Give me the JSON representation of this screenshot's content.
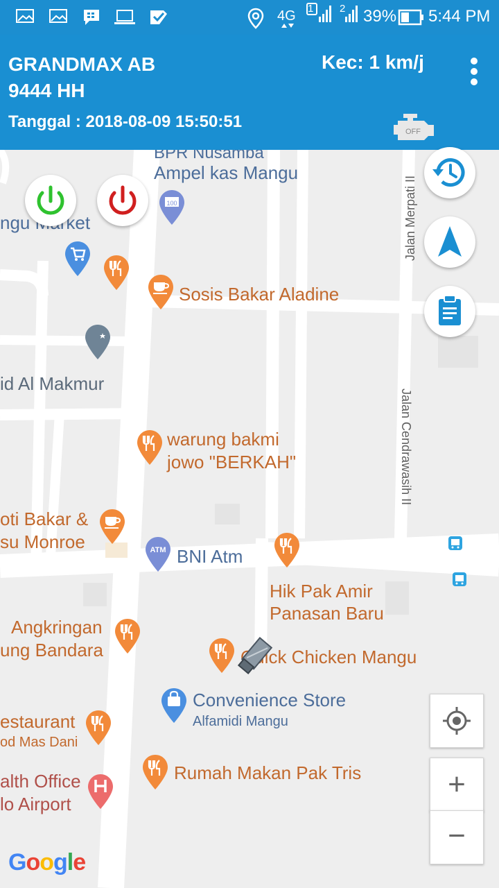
{
  "status_bar": {
    "network": "4G",
    "sim1": "1",
    "sim2": "2",
    "battery": "39%",
    "time": "5:44 PM",
    "icons": [
      "gallery-icon",
      "gallery-icon",
      "bbm-icon",
      "laptop-icon",
      "check-app-icon",
      "location-icon",
      "signal-icon",
      "battery-icon"
    ]
  },
  "header": {
    "vehicle": "GRANDMAX AB\n9444 HH",
    "speed": "Kec: 1 km/j",
    "date": "Tanggal : 2018-08-09 15:50:51",
    "engine_status": "OFF"
  },
  "map": {
    "pois": [
      {
        "name": "BPR Nusamba",
        "line2": "Ampel kas Mangu",
        "color": "blue"
      },
      {
        "name": "ngu Market",
        "color": "blue"
      },
      {
        "name": "Sosis Bakar Aladine",
        "color": "orange"
      },
      {
        "name": "id Al Makmur",
        "color": "slate"
      },
      {
        "name": "warung bakmi",
        "line2": "jowo \"BERKAH\"",
        "color": "orange"
      },
      {
        "name": "oti Bakar &",
        "line2": "su Monroe",
        "color": "orange"
      },
      {
        "name": "BNI Atm",
        "color": "blue"
      },
      {
        "name": "Hik Pak Amir",
        "line2": "Panasan Baru",
        "color": "orange"
      },
      {
        "name": "Angkringan",
        "line2": "ung Bandara",
        "color": "orange"
      },
      {
        "name": "Quick Chicken Mangu",
        "color": "orange"
      },
      {
        "name": "Convenience Store",
        "line2": "Alfamidi Mangu",
        "color": "blue"
      },
      {
        "name": "estaurant",
        "line2": "od Mas Dani",
        "color": "orange"
      },
      {
        "name": "Rumah Makan Pak Tris",
        "color": "orange"
      },
      {
        "name": "alth Office",
        "line2": "lo Airport",
        "color": "red"
      }
    ],
    "streets": [
      "Jalan Merpati II",
      "Jalan Cendrawasih II"
    ],
    "atm_badge": "ATM",
    "bpr_badge": "100",
    "attribution": "Google"
  },
  "controls": {
    "zoom_in": "+",
    "zoom_out": "−",
    "colors": {
      "power_on": "#2fc22f",
      "power_off": "#d01f1f",
      "accent": "#1a8fd2"
    }
  }
}
